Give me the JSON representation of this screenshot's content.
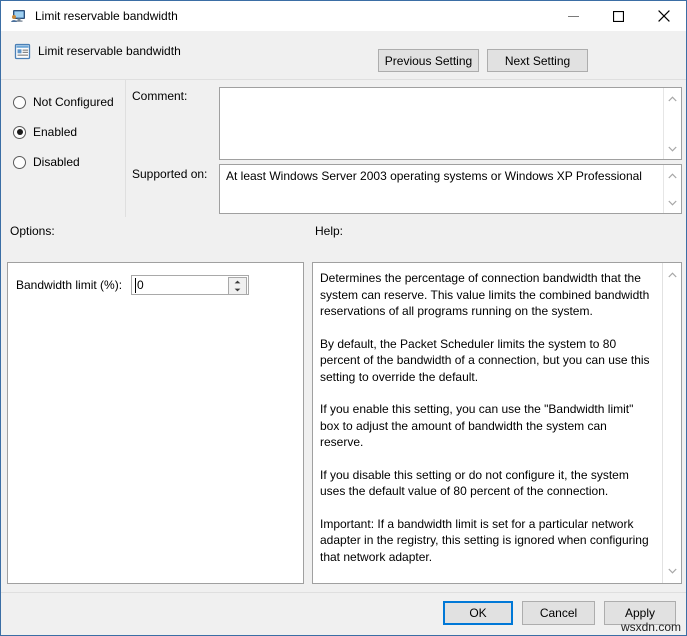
{
  "window": {
    "title": "Limit reservable bandwidth",
    "title_icon": "computer-user-policy-icon",
    "minimize_label": "minimize-icon",
    "maximize_label": "maximize-icon",
    "close_label": "close-icon"
  },
  "header": {
    "icon": "policy-setting-icon",
    "title": "Limit reservable bandwidth",
    "previous_setting_label": "Previous Setting",
    "next_setting_label": "Next Setting"
  },
  "state": {
    "options": [
      {
        "label": "Not Configured",
        "selected": false
      },
      {
        "label": "Enabled",
        "selected": true
      },
      {
        "label": "Disabled",
        "selected": false
      }
    ]
  },
  "comment": {
    "label": "Comment:",
    "value": "",
    "scroll_up_icon": "chevron-up-icon",
    "scroll_down_icon": "chevron-down-icon"
  },
  "supported_on": {
    "label": "Supported on:",
    "value": "At least Windows Server 2003 operating systems or Windows XP Professional",
    "scroll_up_icon": "chevron-up-icon",
    "scroll_down_icon": "chevron-down-icon"
  },
  "options": {
    "label": "Options:",
    "bandwidth_limit_label": "Bandwidth limit (%):",
    "bandwidth_limit_value": "0",
    "spinner_up_icon": "spin-up-icon",
    "spinner_down_icon": "spin-down-icon"
  },
  "help": {
    "label": "Help:",
    "paragraphs": [
      "Determines the percentage of connection bandwidth that the system can reserve. This value limits the combined bandwidth reservations of all programs running on the system.",
      "By default, the Packet Scheduler limits the system to 80 percent of the bandwidth of a connection, but you can use this setting to override the default.",
      "If you enable this setting, you can use the \"Bandwidth limit\" box to adjust the amount of bandwidth the system can reserve.",
      "If you disable this setting or do not configure it, the system uses the default value of 80 percent of the connection.",
      "Important: If a bandwidth limit is set for a particular network adapter in the registry, this setting is ignored when configuring that network adapter."
    ],
    "scroll_up_icon": "chevron-up-icon",
    "scroll_down_icon": "chevron-down-icon"
  },
  "footer": {
    "ok_label": "OK",
    "cancel_label": "Cancel",
    "apply_label": "Apply"
  },
  "watermark": {
    "text": "wsxdn.com"
  },
  "colors": {
    "window_border": "#3b6ea5",
    "body_background": "#f0f0f0",
    "focus_accent": "#0078d7",
    "button_face": "#e1e1e1"
  }
}
